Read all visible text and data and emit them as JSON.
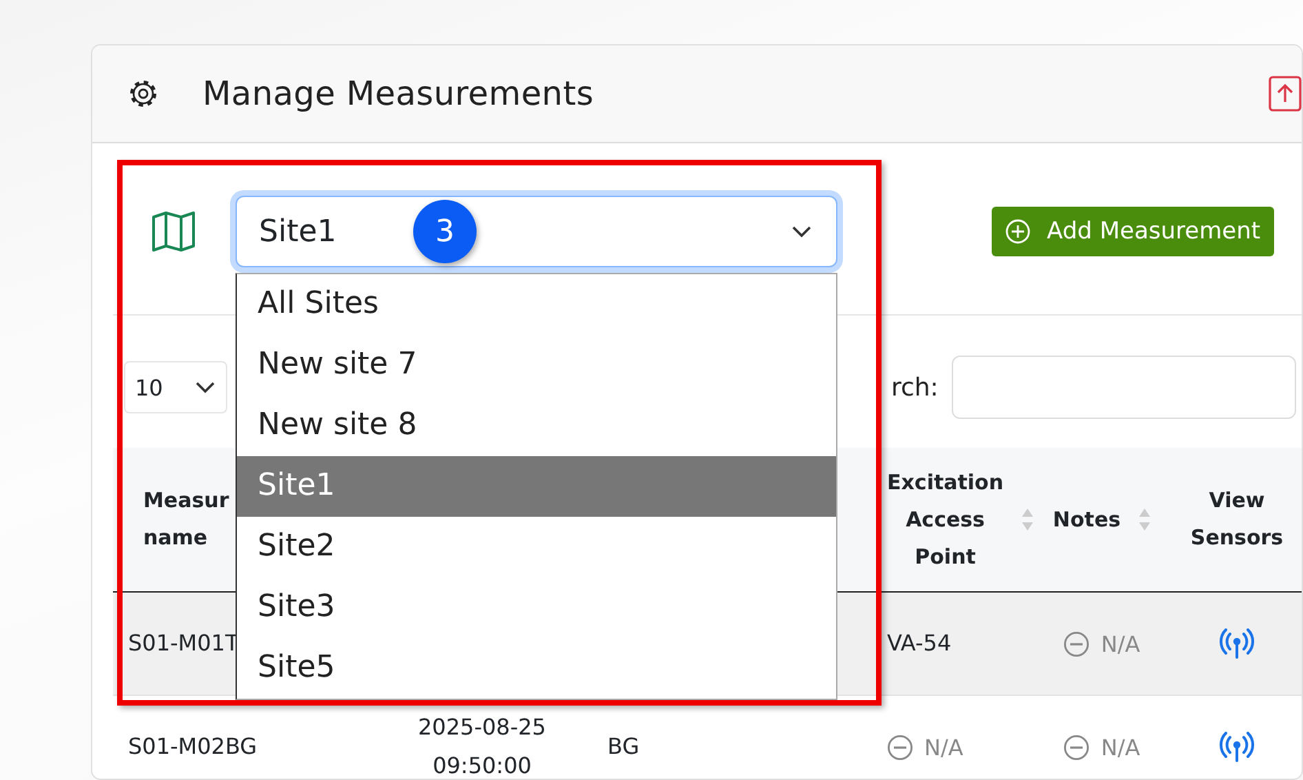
{
  "header": {
    "title": "Manage Measurements"
  },
  "site_filter": {
    "value": "Site1",
    "expanded": true,
    "options": [
      {
        "label": "All Sites",
        "selected": false
      },
      {
        "label": "New site 7",
        "selected": false
      },
      {
        "label": "New site 8",
        "selected": false
      },
      {
        "label": "Site1",
        "selected": true
      },
      {
        "label": "Site2",
        "selected": false
      },
      {
        "label": "Site3",
        "selected": false
      },
      {
        "label": "Site5",
        "selected": false
      }
    ]
  },
  "callout": {
    "number": "3"
  },
  "add_button": {
    "label": "Add Measurement"
  },
  "page_length": {
    "value": "10"
  },
  "search": {
    "label": "rch:"
  },
  "table": {
    "columns": [
      {
        "label": "Measur name",
        "sortable": false
      },
      null,
      null,
      {
        "label": "Excitation Access Point",
        "sortable": true
      },
      {
        "label": "Notes",
        "sortable": true
      },
      {
        "label": "View Sensors",
        "sortable": false
      }
    ],
    "rows": [
      {
        "highlighted": true,
        "cells": [
          {
            "kind": "text",
            "text": "S01-M01T"
          },
          null,
          null,
          {
            "kind": "text",
            "text": "VA-54"
          },
          {
            "kind": "na",
            "text": "N/A"
          },
          {
            "kind": "sensors"
          }
        ]
      },
      {
        "highlighted": false,
        "cells": [
          {
            "kind": "text",
            "text": "S01-M02BG"
          },
          {
            "kind": "text",
            "text": "2025-08-25 09:50:00"
          },
          {
            "kind": "text",
            "text": "BG"
          },
          {
            "kind": "na",
            "text": "N/A"
          },
          {
            "kind": "na",
            "text": "N/A"
          },
          {
            "kind": "sensors"
          }
        ]
      }
    ]
  }
}
